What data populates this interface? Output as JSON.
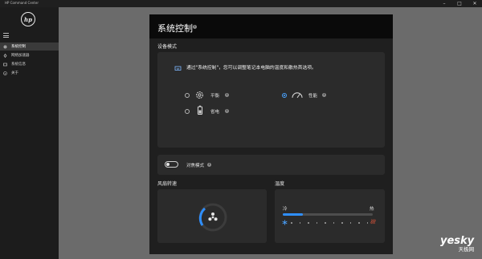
{
  "window": {
    "title": "HP Command Center",
    "controls": {
      "minimize": "–",
      "maximize": "□",
      "close": "✕"
    }
  },
  "sidebar": {
    "logo": "hp",
    "items": [
      {
        "label": "系统控制",
        "icon": "system-control-icon",
        "active": true
      },
      {
        "label": "网络加速器",
        "icon": "network-booster-icon",
        "active": false
      },
      {
        "label": "系统信息",
        "icon": "system-info-icon",
        "active": false
      },
      {
        "label": "关于",
        "icon": "about-icon",
        "active": false
      }
    ]
  },
  "main": {
    "title": "系统控制",
    "device_mode": {
      "section_label": "设备模式",
      "description": "通过\"系统控制\"，您可以调整笔记本电脑的温度和散热首选项。",
      "options": [
        {
          "label": "平衡",
          "icon": "balance-gear-icon",
          "selected": false
        },
        {
          "label": "性能",
          "icon": "performance-gauge-icon",
          "selected": true
        },
        {
          "label": "省电",
          "icon": "battery-icon",
          "selected": false
        }
      ]
    },
    "quiet_mode": {
      "label": "对焦模式",
      "enabled": false
    },
    "fan": {
      "section_label": "风扇转速",
      "icon": "fan-icon"
    },
    "temperature": {
      "section_label": "温度",
      "cold_label": "冷",
      "hot_label": "热",
      "level": 0.22,
      "colors": {
        "fill": "#2f8fff",
        "cold_icon": "#4aa3ff",
        "hot_icon": "#e0553a"
      }
    }
  },
  "watermark": {
    "line1": "yesky",
    "line2": "天极网"
  }
}
